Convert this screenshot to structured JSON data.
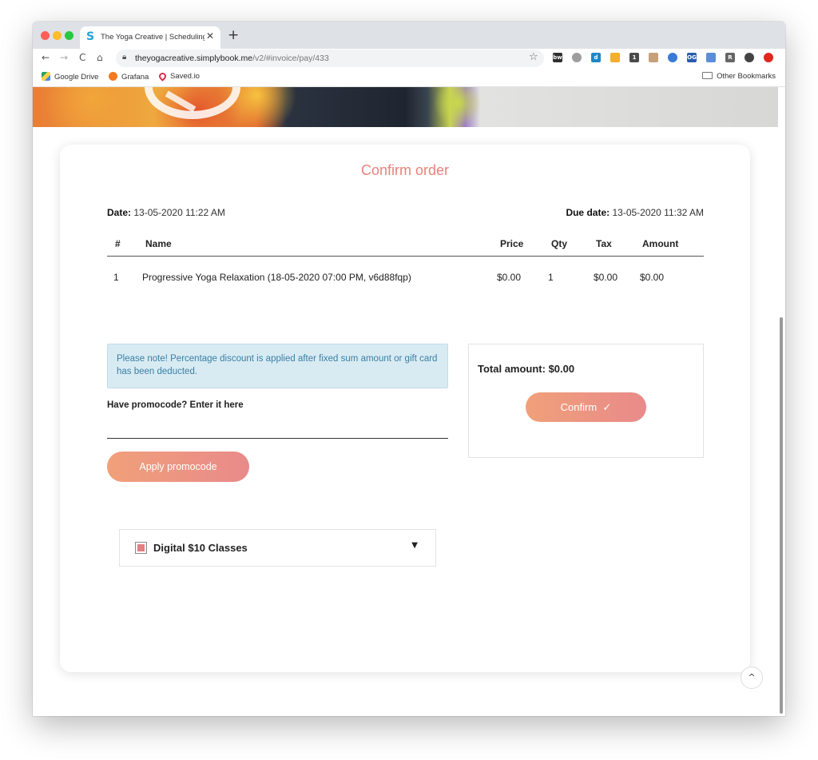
{
  "browser": {
    "tab_title": "The Yoga Creative | Scheduling",
    "tab_close": "✕",
    "new_tab": "+",
    "nav": {
      "back": "←",
      "forward": "→",
      "reload": "C",
      "home": "⌂"
    },
    "url_host": "theyogacreative.simplybook.me",
    "url_path": "/v2/#invoice/pay/433",
    "bookmarks": [
      {
        "label": "Google Drive"
      },
      {
        "label": "Grafana"
      },
      {
        "label": "Saved.io"
      }
    ],
    "other_bookmarks": "Other Bookmarks",
    "extensions": [
      {
        "icon": "bw-icon",
        "text": "bw",
        "color": "#2f2f2f"
      },
      {
        "icon": "ext-grey-icon",
        "text": "",
        "color": "#9e9e9e"
      },
      {
        "icon": "d-icon",
        "text": "d",
        "color": "#1e87c7"
      },
      {
        "icon": "gear-ext-icon",
        "text": "",
        "color": "#f3b02a"
      },
      {
        "icon": "onepassword-icon",
        "text": "1",
        "color": "#4a4a4a"
      },
      {
        "icon": "face-icon",
        "text": "",
        "color": "#c7a07a"
      },
      {
        "icon": "globe-ext-icon",
        "text": "",
        "color": "#3a7bd5"
      },
      {
        "icon": "og-icon",
        "text": "OG",
        "color": "#2a5db0"
      },
      {
        "icon": "window-ext-icon",
        "text": "",
        "color": "#5b8ed6"
      },
      {
        "icon": "r-icon",
        "text": "R",
        "color": "#666666"
      },
      {
        "icon": "account-icon",
        "text": "",
        "color": "#444444"
      },
      {
        "icon": "update-icon",
        "text": "",
        "color": "#e1261c"
      }
    ]
  },
  "page": {
    "title": "Confirm order",
    "date_label": "Date:",
    "date_value": "13-05-2020 11:22 AM",
    "due_label": "Due date:",
    "due_value": "13-05-2020 11:32 AM",
    "table": {
      "headers": [
        "#",
        "Name",
        "Price",
        "Qty",
        "Tax",
        "Amount"
      ],
      "rows": [
        [
          "1",
          "Progressive Yoga Relaxation (18-05-2020 07:00 PM, v6d88fqp)",
          "$0.00",
          "1",
          "$0.00",
          "$0.00"
        ]
      ]
    },
    "notice": "Please note! Percentage discount is applied after fixed sum amount or gift card has been deducted.",
    "promo_label": "Have promocode? Enter it here",
    "promo_value": "",
    "apply_label": "Apply promocode",
    "total_label": "Total amount: $0.00",
    "confirm_label": "Confirm",
    "confirm_icon": "✓",
    "package_label": "Digital $10 Classes",
    "package_caret": "▼",
    "scroll_top": "^"
  },
  "colors": {
    "accent": "#e9827c",
    "button_gradient_start": "#f0a07a",
    "button_gradient_end": "#e98a8a",
    "notice_bg": "#d8ebf3",
    "notice_text": "#3a7fa4"
  }
}
